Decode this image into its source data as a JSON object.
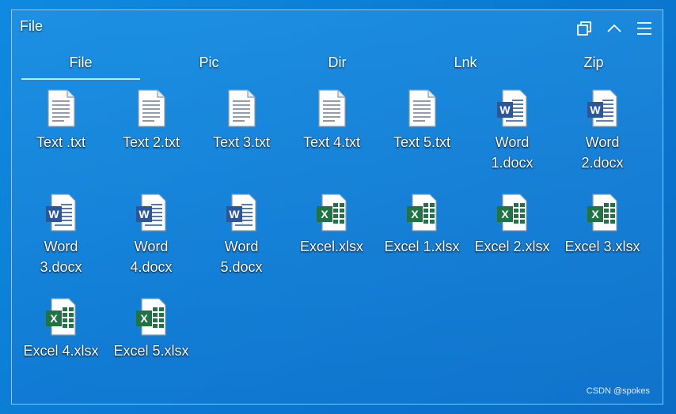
{
  "window": {
    "title": "File"
  },
  "tabs": [
    {
      "label": "File",
      "active": true
    },
    {
      "label": "Pic"
    },
    {
      "label": "Dir"
    },
    {
      "label": "Lnk"
    },
    {
      "label": "Zip"
    }
  ],
  "files": [
    {
      "name": "Text .txt",
      "type": "txt"
    },
    {
      "name": "Text 2.txt",
      "type": "txt"
    },
    {
      "name": "Text 3.txt",
      "type": "txt"
    },
    {
      "name": "Text 4.txt",
      "type": "txt"
    },
    {
      "name": "Text 5.txt",
      "type": "txt"
    },
    {
      "name": "Word 1.docx",
      "type": "docx"
    },
    {
      "name": "Word 2.docx",
      "type": "docx"
    },
    {
      "name": "Word 3.docx",
      "type": "docx"
    },
    {
      "name": "Word 4.docx",
      "type": "docx"
    },
    {
      "name": "Word 5.docx",
      "type": "docx"
    },
    {
      "name": "Excel.xlsx",
      "type": "xlsx"
    },
    {
      "name": "Excel 1.xlsx",
      "type": "xlsx"
    },
    {
      "name": "Excel 2.xlsx",
      "type": "xlsx"
    },
    {
      "name": "Excel 3.xlsx",
      "type": "xlsx"
    },
    {
      "name": "Excel 4.xlsx",
      "type": "xlsx"
    },
    {
      "name": "Excel 5.xlsx",
      "type": "xlsx"
    }
  ],
  "icons": {
    "restore": "window-restore-icon",
    "collapse": "chevron-up-icon",
    "menu": "hamburger-menu-icon"
  },
  "colors": {
    "word": "#2b579a",
    "excel": "#217346"
  },
  "watermark": "CSDN @spokes"
}
